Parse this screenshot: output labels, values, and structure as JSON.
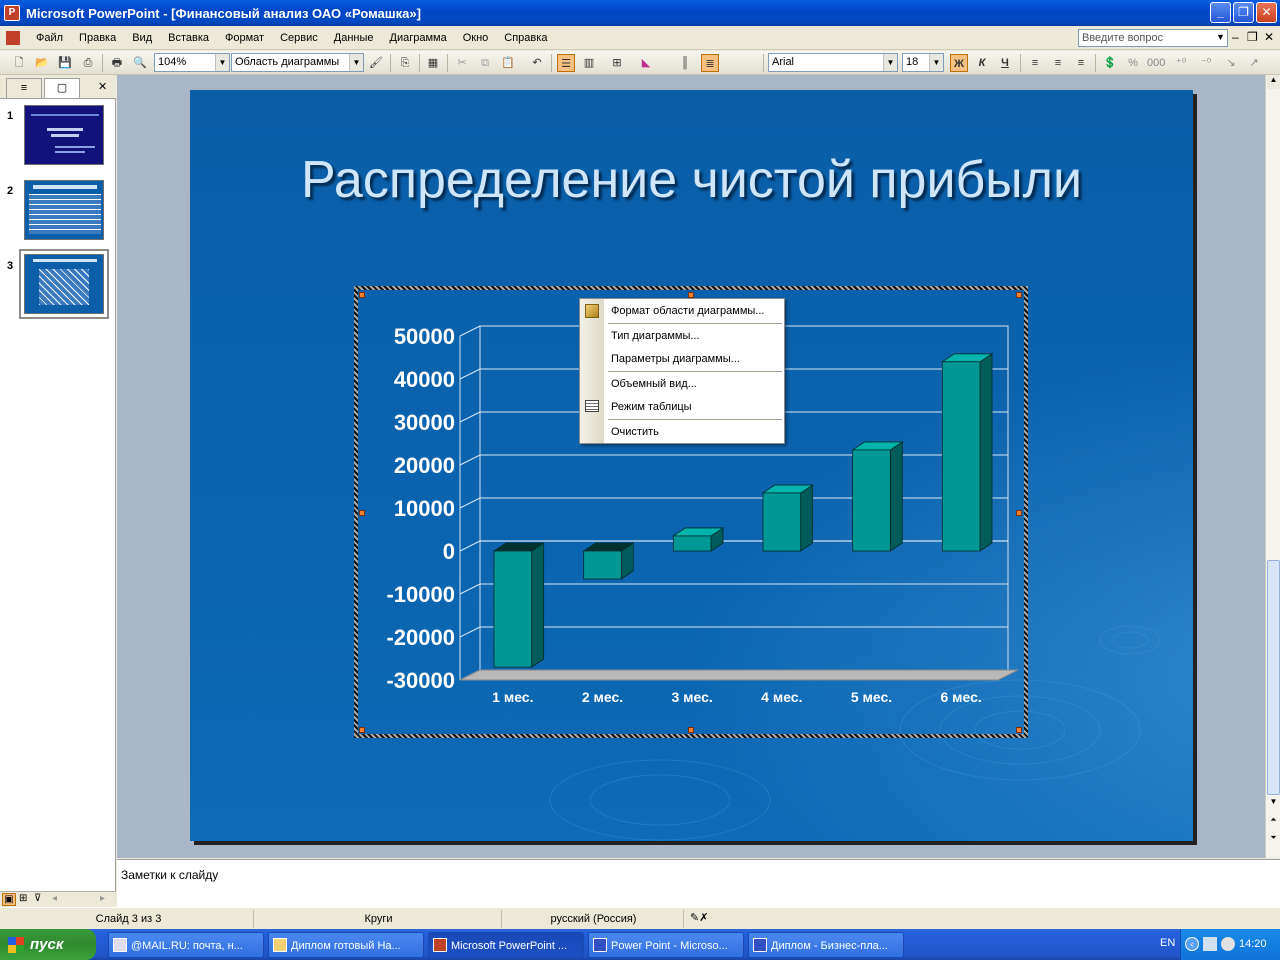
{
  "window": {
    "title": "Microsoft PowerPoint - [Финансовый анализ ОАО «Ромашка»]",
    "controls": {
      "minimize": "_",
      "restore": "❐",
      "close": "✕"
    }
  },
  "menu": {
    "items": [
      "Файл",
      "Правка",
      "Вид",
      "Вставка",
      "Формат",
      "Сервис",
      "Данные",
      "Диаграмма",
      "Окно",
      "Справка"
    ],
    "help_placeholder": "Введите вопрос"
  },
  "toolbar": {
    "zoom": "104%",
    "object_selector": "Область диаграммы",
    "font": "Arial",
    "font_size": "18",
    "bold": "Ж",
    "italic": "К",
    "underline": "Ч"
  },
  "slides_panel": {
    "tabs": [
      "≡",
      "▢"
    ],
    "slides": [
      {
        "num": "1"
      },
      {
        "num": "2"
      },
      {
        "num": "3"
      }
    ]
  },
  "slide": {
    "title": "Распределение чистой прибыли"
  },
  "chart_data": {
    "type": "bar",
    "title": "",
    "xlabel": "",
    "ylabel": "",
    "categories": [
      "1 мес.",
      "2 мес.",
      "3 мес.",
      "4 мес.",
      "5 мес.",
      "6 мес."
    ],
    "values": [
      -27000,
      -6500,
      3500,
      13500,
      23500,
      44000
    ],
    "ylim": [
      -30000,
      50000
    ],
    "yticks": [
      "50000",
      "40000",
      "30000",
      "20000",
      "10000",
      "0",
      "-10000",
      "-20000",
      "-30000"
    ],
    "grid": true,
    "style": "3d-column",
    "colors": {
      "bar_front": "#009894",
      "bar_side": "#005c5a",
      "bar_top": "#00b4ae"
    }
  },
  "context_menu": {
    "items": [
      {
        "label": "Формат области диаграммы...",
        "icon": "format-icon"
      },
      {
        "label": "Тип диаграммы..."
      },
      {
        "label": "Параметры диаграммы..."
      },
      {
        "label": "Объемный вид..."
      },
      {
        "label": "Режим таблицы",
        "icon": "table-icon"
      },
      {
        "label": "Очистить"
      }
    ]
  },
  "notes": {
    "placeholder": "Заметки к слайду"
  },
  "statusbar": {
    "slide_info": "Слайд 3 из 3",
    "design": "Круги",
    "language": "русский (Россия)"
  },
  "taskbar": {
    "start": "пуск",
    "tasks": [
      {
        "label": "@MAIL.RU: почта, н..."
      },
      {
        "label": "Диплом готовый На..."
      },
      {
        "label": "Microsoft PowerPoint ..."
      },
      {
        "label": "Power Point - Microso..."
      },
      {
        "label": "Диплом - Бизнес-пла..."
      }
    ],
    "tray": {
      "lang": "EN",
      "time": "14:20"
    }
  }
}
